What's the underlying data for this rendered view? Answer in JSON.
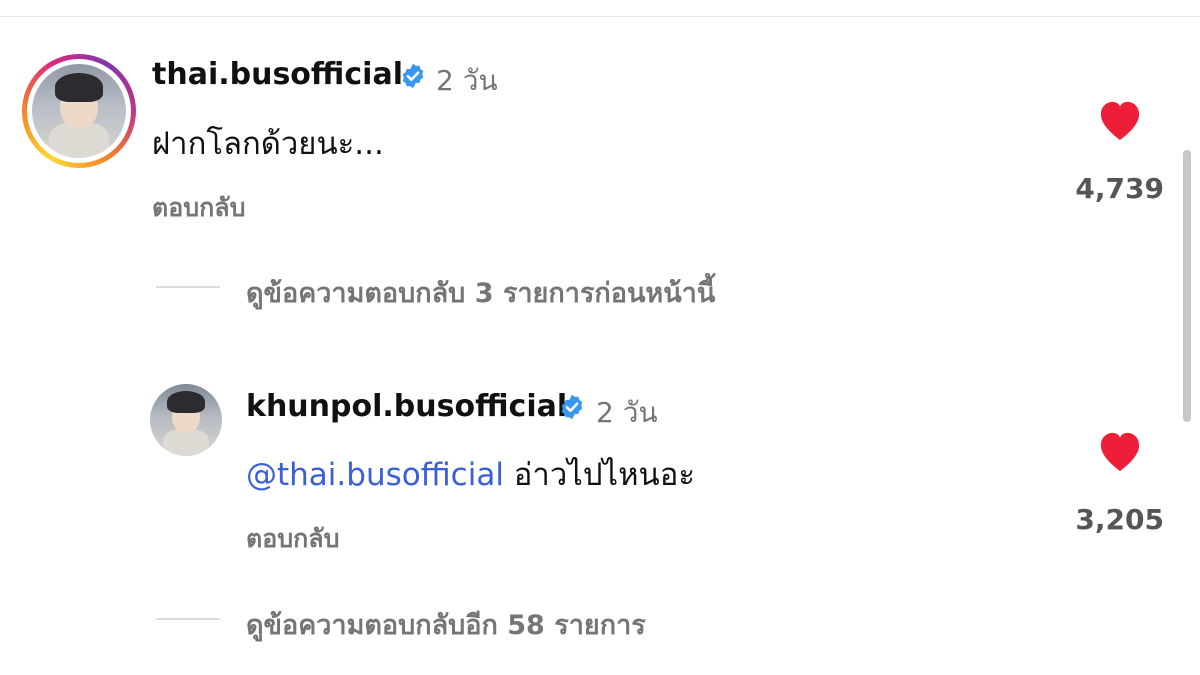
{
  "comments": [
    {
      "username": "thai.busofficial",
      "time": "2 วัน",
      "text": "ฝากโลกด้วยนะ...",
      "reply_label": "ตอบกลับ",
      "likes": "4,739",
      "avatar_icon": "profile-photo",
      "has_story_ring": true
    },
    {
      "username": "khunpol.busofficial",
      "time": "2 วัน",
      "mention": "@thai.busofficial",
      "text": " อ่าวไปไหนอะ",
      "reply_label": "ตอบกลับ",
      "likes": "3,205",
      "avatar_icon": "profile-photo"
    }
  ],
  "view_previous_replies": "ดูข้อความตอบกลับ 3 รายการก่อนหน้านี้",
  "view_more_replies": "ดูข้อความตอบกลับอีก 58 รายการ",
  "icons": {
    "verified": "verified-badge-icon",
    "like": "heart-icon"
  },
  "colors": {
    "heart": "#ee1d38",
    "verified": "#3897f0",
    "mention": "#3b5fd9",
    "muted_text": "#757575"
  }
}
